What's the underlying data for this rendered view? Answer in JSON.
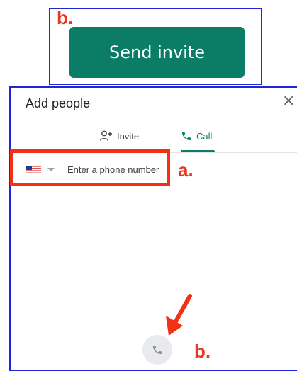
{
  "annotations": {
    "label_b_top": "b.",
    "label_a": "a.",
    "label_b_bottom": "b."
  },
  "invite_button": {
    "label": "Send invite"
  },
  "dialog": {
    "title": "Add people",
    "close_symbol": "×",
    "tabs": [
      {
        "label": "Invite",
        "icon": "add-person-icon"
      },
      {
        "label": "Call",
        "icon": "phone-icon",
        "selected": true
      }
    ],
    "phone_input": {
      "placeholder": "Enter a phone number",
      "value": ""
    },
    "country": "US"
  },
  "colors": {
    "accent": "#0b7d66",
    "highlight": "#f23013",
    "frame": "#2026d6"
  }
}
